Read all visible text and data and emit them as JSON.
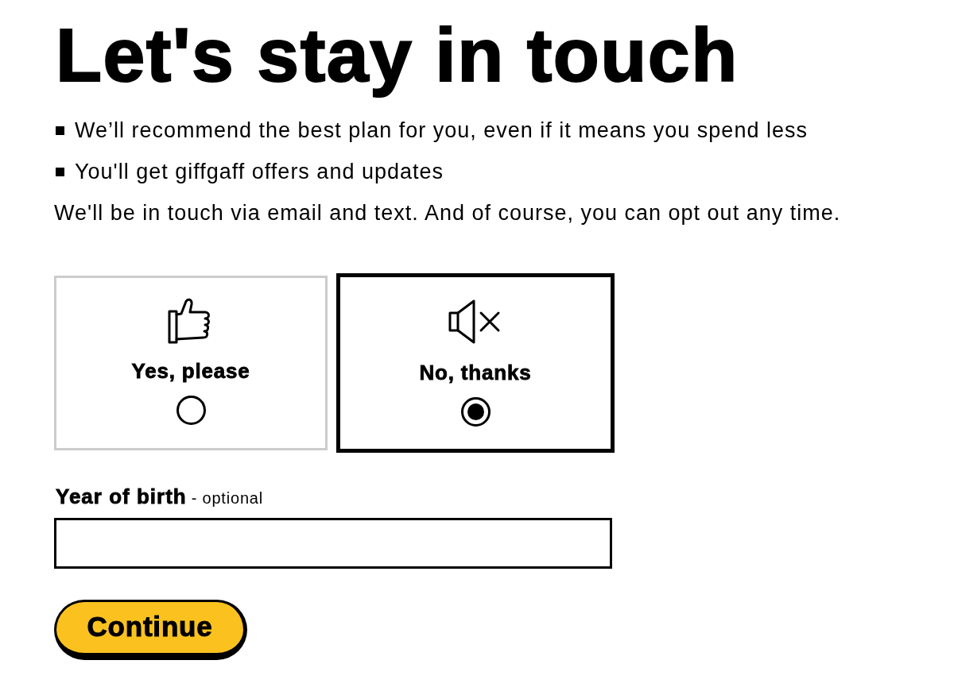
{
  "heading": "Let's stay in touch",
  "benefits": [
    {
      "text": "We’ll recommend the best plan for you, even if it means you spend less"
    },
    {
      "text": "You'll get giffgaff offers and updates"
    }
  ],
  "note": "We'll be in touch via email and text. And of course, you can opt out any time.",
  "options": [
    {
      "kind": "thumbs_up",
      "label": "Yes, please",
      "selected": false
    },
    {
      "kind": "muted",
      "label": "No, thanks",
      "selected": true
    }
  ],
  "year_of_birth": {
    "label": "Year of birth",
    "hint": "- optional"
  },
  "continue_button": "Continue"
}
